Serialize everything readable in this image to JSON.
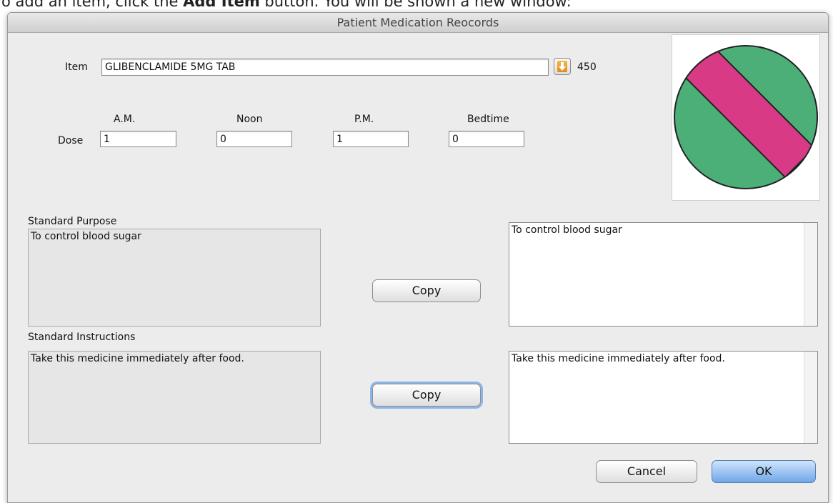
{
  "doc": {
    "prefix": "o add an item, click the ",
    "bold": "Add Item",
    "suffix": " button. You will be shown a new window:"
  },
  "window": {
    "title": "Patient Medication Reocords"
  },
  "item": {
    "label": "Item",
    "value": "GLIBENCLAMIDE 5MG TAB",
    "code": "450"
  },
  "dose": {
    "label": "Dose",
    "slots": [
      {
        "label": "A.M.",
        "value": "1"
      },
      {
        "label": "Noon",
        "value": "0"
      },
      {
        "label": "P.M.",
        "value": "1"
      },
      {
        "label": "Bedtime",
        "value": "0"
      }
    ]
  },
  "purpose": {
    "label": "Standard Purpose",
    "standard_text": "To control blood sugar",
    "patient_text": "To control blood sugar",
    "copy_label": "Copy"
  },
  "instructions": {
    "label": "Standard Instructions",
    "standard_text": "Take this medicine immediately after food.",
    "patient_text": "Take this medicine immediately after food.",
    "copy_label": "Copy"
  },
  "buttons": {
    "cancel": "Cancel",
    "ok": "OK"
  },
  "colors": {
    "pill_body": "#4daf78",
    "pill_stripe": "#d93a86",
    "default_button": "#6fa7e8"
  }
}
